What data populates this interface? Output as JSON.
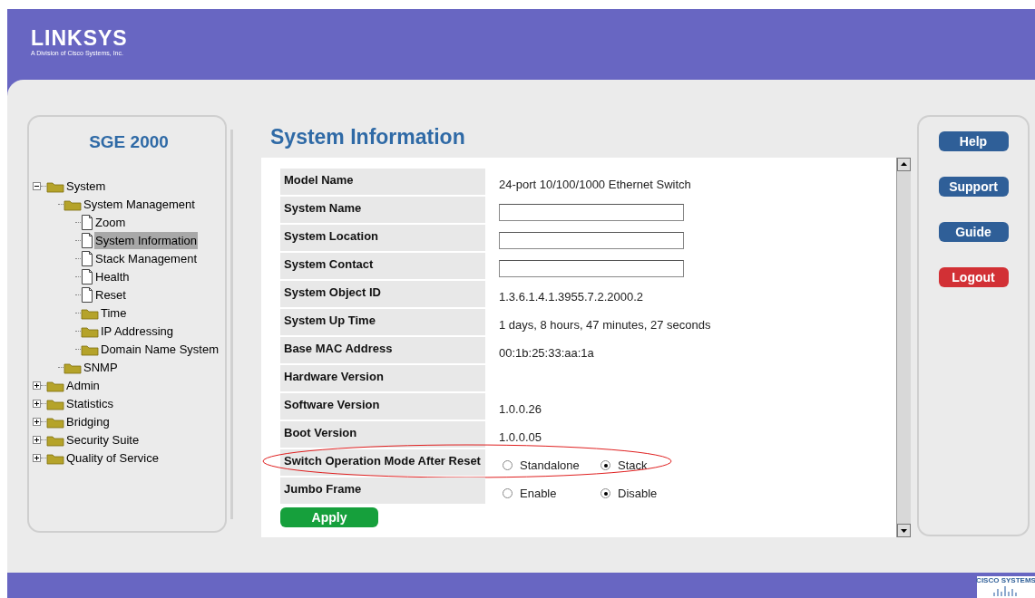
{
  "header": {
    "logo": "LINKSYS",
    "tagline": "A Division of Cisco Systems, Inc."
  },
  "sidebar": {
    "title": "SGE 2000",
    "tree": [
      {
        "label": "System",
        "kind": "folder",
        "expanded": true,
        "selected": false,
        "children": [
          {
            "label": "System Management",
            "kind": "folder",
            "selected": false,
            "children": [
              {
                "label": "Zoom",
                "kind": "page",
                "selected": false
              },
              {
                "label": "System Information",
                "kind": "page",
                "selected": true
              },
              {
                "label": "Stack Management",
                "kind": "page",
                "selected": false
              },
              {
                "label": "Health",
                "kind": "page",
                "selected": false
              },
              {
                "label": "Reset",
                "kind": "page",
                "selected": false
              },
              {
                "label": "Time",
                "kind": "folder",
                "selected": false
              },
              {
                "label": "IP Addressing",
                "kind": "folder",
                "selected": false
              },
              {
                "label": "Domain Name System",
                "kind": "folder",
                "selected": false
              }
            ]
          },
          {
            "label": "SNMP",
            "kind": "folder",
            "selected": false
          }
        ]
      },
      {
        "label": "Admin",
        "kind": "folder",
        "expanded": false,
        "selected": false
      },
      {
        "label": "Statistics",
        "kind": "folder",
        "expanded": false,
        "selected": false
      },
      {
        "label": "Bridging",
        "kind": "folder",
        "expanded": false,
        "selected": false
      },
      {
        "label": "Security Suite",
        "kind": "folder",
        "expanded": false,
        "selected": false
      },
      {
        "label": "Quality of Service",
        "kind": "folder",
        "expanded": false,
        "selected": false
      }
    ]
  },
  "page_title": "System Information",
  "rows": [
    {
      "label": "Model Name",
      "kind": "text",
      "value": "24-port 10/100/1000 Ethernet Switch"
    },
    {
      "label": "System Name",
      "kind": "input"
    },
    {
      "label": "System Location",
      "kind": "input"
    },
    {
      "label": "System Contact",
      "kind": "input"
    },
    {
      "label": "System Object ID",
      "kind": "text",
      "value": "1.3.6.1.4.1.3955.7.2.2000.2"
    },
    {
      "label": "System Up Time",
      "kind": "text",
      "value": "1 days, 8 hours, 47 minutes, 27 seconds"
    },
    {
      "label": "Base MAC Address",
      "kind": "text",
      "value": "00:1b:25:33:aa:1a"
    },
    {
      "label": "Hardware Version",
      "kind": "text"
    },
    {
      "label": "Software Version",
      "kind": "text",
      "value": "1.0.0.26"
    },
    {
      "label": "Boot Version",
      "kind": "text",
      "value": "1.0.0.05"
    },
    {
      "label": "Switch Operation Mode After Reset",
      "kind": "radio",
      "highlighted": true,
      "options": [
        {
          "label": "Standalone",
          "selected": false
        },
        {
          "label": "Stack",
          "selected": true
        }
      ]
    },
    {
      "label": "Jumbo Frame",
      "kind": "radio",
      "options": [
        {
          "label": "Enable",
          "selected": false
        },
        {
          "label": "Disable",
          "selected": true
        }
      ]
    }
  ],
  "apply_button": "Apply",
  "side_buttons": [
    {
      "label": "Help",
      "kind": "normal"
    },
    {
      "label": "Support",
      "kind": "normal"
    },
    {
      "label": "Guide",
      "kind": "normal"
    },
    {
      "label": "Logout",
      "kind": "danger"
    }
  ],
  "footer": {
    "logo": "CISCO SYSTEMS"
  }
}
